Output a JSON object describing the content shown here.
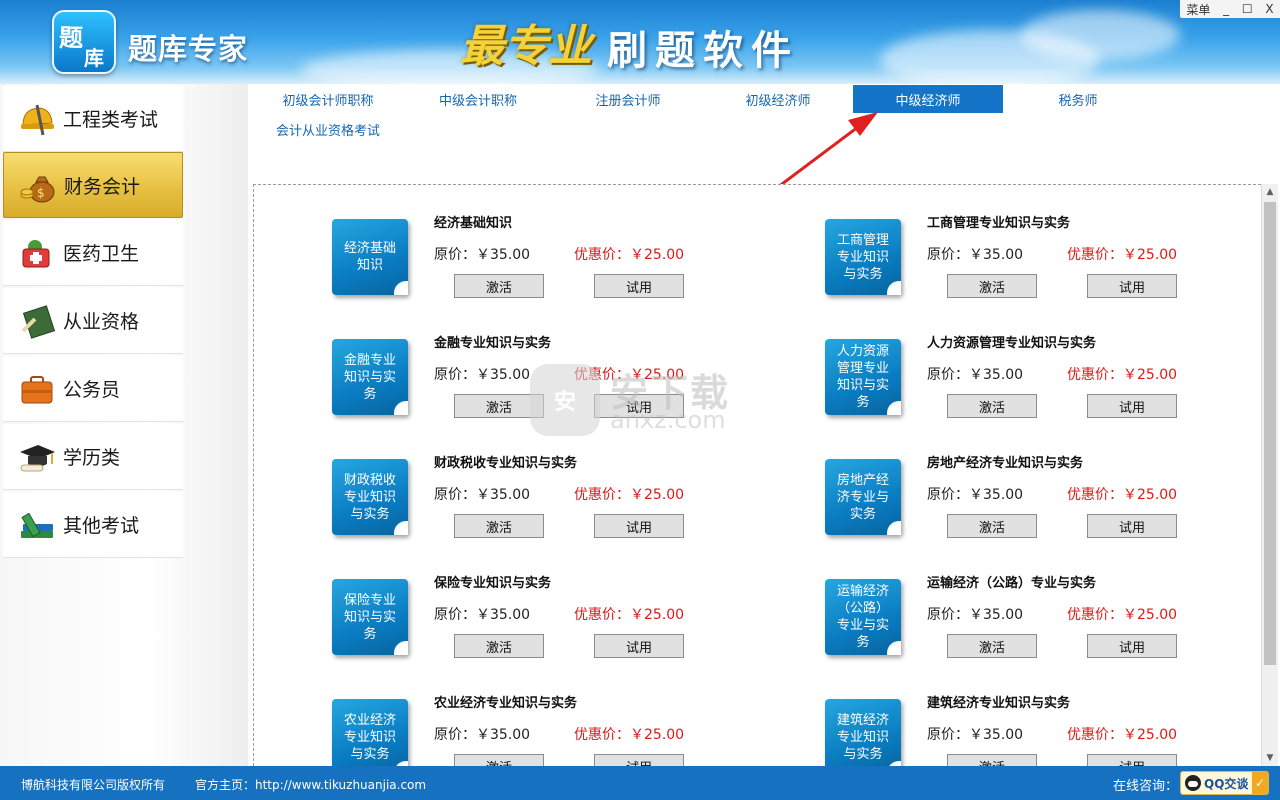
{
  "window": {
    "menu_label": "菜单",
    "minimize": "_",
    "maximize": "☐",
    "close": "X"
  },
  "header": {
    "logo_char_1": "题",
    "logo_char_2": "库",
    "app_title": "题库专家",
    "brand_mark": "最专业",
    "slogan": "刷题软件"
  },
  "sidebar": {
    "items": [
      {
        "label": "工程类考试",
        "icon": "helmet-icon"
      },
      {
        "label": "财务会计",
        "icon": "money-bag-icon"
      },
      {
        "label": "医药卫生",
        "icon": "medical-kit-icon"
      },
      {
        "label": "从业资格",
        "icon": "certificate-icon"
      },
      {
        "label": "公务员",
        "icon": "briefcase-icon"
      },
      {
        "label": "学历类",
        "icon": "graduation-cap-icon"
      },
      {
        "label": "其他考试",
        "icon": "books-icon"
      }
    ],
    "active_index": 1
  },
  "tabs": [
    {
      "label": "初级会计师职称"
    },
    {
      "label": "中级会计职称"
    },
    {
      "label": "注册会计师"
    },
    {
      "label": "初级经济师"
    },
    {
      "label": "中级经济师"
    },
    {
      "label": "税务师"
    },
    {
      "label": "会计从业资格考试"
    }
  ],
  "active_tab_index": 4,
  "product_common": {
    "original_price_text": "原价：￥35.00",
    "sale_price_text": "优惠价：￥25.00",
    "activate_label": "激活",
    "trial_label": "试用"
  },
  "products": [
    {
      "cover": "经济基础知识",
      "name": "经济基础知识"
    },
    {
      "cover": "工商管理专业知识与实务",
      "name": "工商管理专业知识与实务"
    },
    {
      "cover": "金融专业知识与实务",
      "name": "金融专业知识与实务"
    },
    {
      "cover": "人力资源管理专业知识与实务",
      "name": "人力资源管理专业知识与实务"
    },
    {
      "cover": "财政税收专业知识与实务",
      "name": "财政税收专业知识与实务"
    },
    {
      "cover": "房地产经济专业与实务",
      "name": "房地产经济专业知识与实务"
    },
    {
      "cover": "保险专业知识与实务",
      "name": "保险专业知识与实务"
    },
    {
      "cover": "运输经济（公路）专业与实务",
      "name": "运输经济（公路）专业与实务"
    },
    {
      "cover": "农业经济专业知识与实务",
      "name": "农业经济专业知识与实务"
    },
    {
      "cover": "建筑经济专业知识与实务",
      "name": "建筑经济专业知识与实务"
    }
  ],
  "watermark": {
    "text": "安下载",
    "url": "anxz.com",
    "shield_char": "安"
  },
  "footer": {
    "copyright": "博航科技有限公司版权所有",
    "homepage": "官方主页：http://www.tikuzhuanjia.com",
    "consult_label": "在线咨询：",
    "qq_label": "QQ交谈"
  },
  "colors": {
    "header_blue": "#1b7fd0",
    "active_tab": "#1474c8",
    "sidebar_active_gold": "#e8c143",
    "sale_price_red": "#e01818",
    "footer_blue": "#1671c0",
    "annotation_arrow": "#e02020"
  }
}
